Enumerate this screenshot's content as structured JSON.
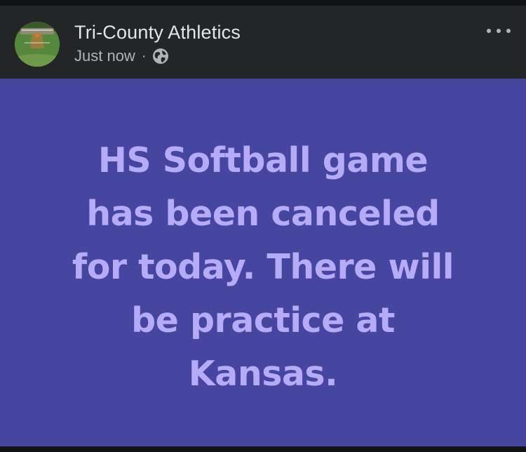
{
  "post": {
    "author_name": "Tri-County Athletics",
    "timestamp": "Just now",
    "separator": "·",
    "audience_icon": "globe-icon",
    "more_icon": "more-options-icon",
    "body_lines": [
      "HS Softball game",
      "has been canceled",
      "for today. There will",
      "be practice at",
      "Kansas."
    ]
  },
  "colors": {
    "header_background": "#242526",
    "post_background": "#4645a0",
    "post_text": "#b5abf6",
    "name_text": "#e4e6eb",
    "meta_text": "#b0b3b8"
  }
}
